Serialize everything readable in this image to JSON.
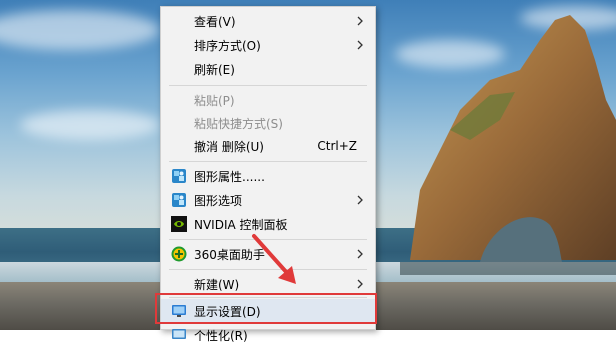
{
  "context_menu": {
    "items": [
      {
        "label": "查看(V)",
        "disabled": false,
        "has_submenu": true
      },
      {
        "label": "排序方式(O)",
        "disabled": false,
        "has_submenu": true
      },
      {
        "label": "刷新(E)",
        "disabled": false,
        "has_submenu": false
      },
      {
        "label": "粘贴(P)",
        "disabled": true,
        "has_submenu": false
      },
      {
        "label": "粘贴快捷方式(S)",
        "disabled": true,
        "has_submenu": false
      },
      {
        "label": "撤消 删除(U)",
        "shortcut": "Ctrl+Z",
        "disabled": false,
        "has_submenu": false
      },
      {
        "label": "图形属性......",
        "icon": "intel-graphics-icon",
        "disabled": false,
        "has_submenu": false
      },
      {
        "label": "图形选项",
        "icon": "intel-graphics-icon",
        "disabled": false,
        "has_submenu": true
      },
      {
        "label": "NVIDIA 控制面板",
        "icon": "nvidia-icon",
        "disabled": false,
        "has_submenu": false
      },
      {
        "label": "360桌面助手",
        "icon": "360-icon",
        "disabled": false,
        "has_submenu": true
      },
      {
        "label": "新建(W)",
        "disabled": false,
        "has_submenu": true
      },
      {
        "label": "显示设置(D)",
        "icon": "display-settings-icon",
        "disabled": false,
        "has_submenu": false,
        "highlighted": true
      },
      {
        "label": "个性化(R)",
        "icon": "personalize-icon",
        "disabled": false,
        "has_submenu": false
      }
    ]
  },
  "annotation": {
    "highlight_color": "#e03a3a",
    "arrow_color": "#e03a3a"
  },
  "colors": {
    "menu_bg": "#f2f2f2",
    "menu_text": "#000000",
    "disabled_text": "#8d8d8d"
  }
}
